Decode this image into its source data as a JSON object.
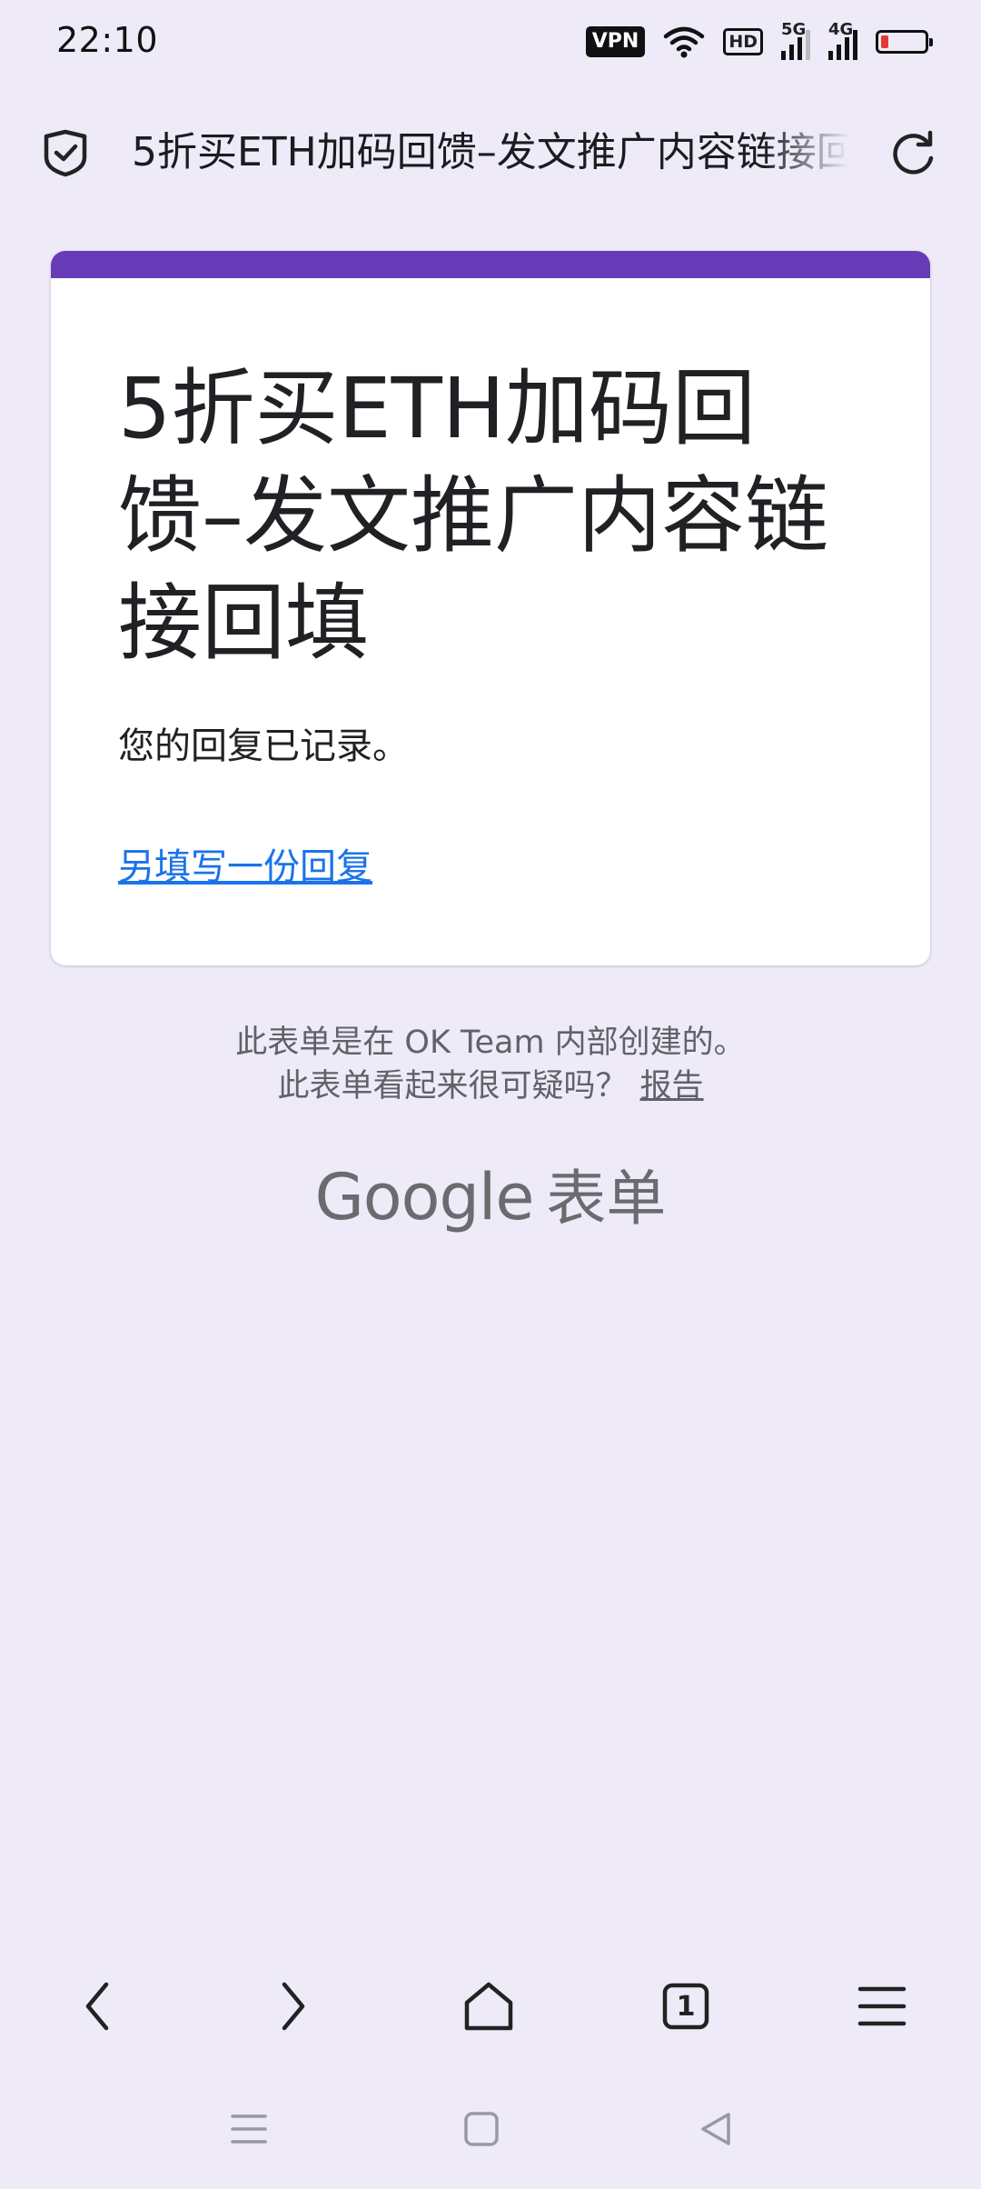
{
  "status_bar": {
    "time": "22:10",
    "vpn_label": "VPN",
    "hd_label": "HD",
    "network_5g": "5G",
    "network_4g": "4G",
    "icons": [
      "vpn-icon",
      "wifi-icon",
      "hd-icon",
      "signal-5g-icon",
      "signal-4g-icon",
      "battery-low-icon"
    ],
    "battery_color": "#E53935"
  },
  "toolbar": {
    "page_title": "5折买ETH加码回馈–发文推广内容链接回填",
    "security_icon": "shield-check-icon",
    "reload_icon": "reload-icon"
  },
  "form": {
    "accent_color": "#673AB7",
    "title": "5折买ETH加码回馈–发文推广内容链接回填",
    "confirmation": "您的回复已记录。",
    "another_response_link": "另填写一份回复"
  },
  "footer": {
    "created_by": "此表单是在 OK Team 内部创建的。",
    "suspicious": "此表单看起来很可疑吗？",
    "report_link": "报告",
    "brand_google": "Google",
    "brand_forms": "表单"
  },
  "browser_nav": {
    "tab_count": "1",
    "icons": [
      "back-icon",
      "forward-icon",
      "home-icon",
      "tabs-icon",
      "menu-icon"
    ]
  },
  "system_nav": {
    "icons": [
      "recents-icon",
      "home-square-icon",
      "back-triangle-icon"
    ]
  }
}
